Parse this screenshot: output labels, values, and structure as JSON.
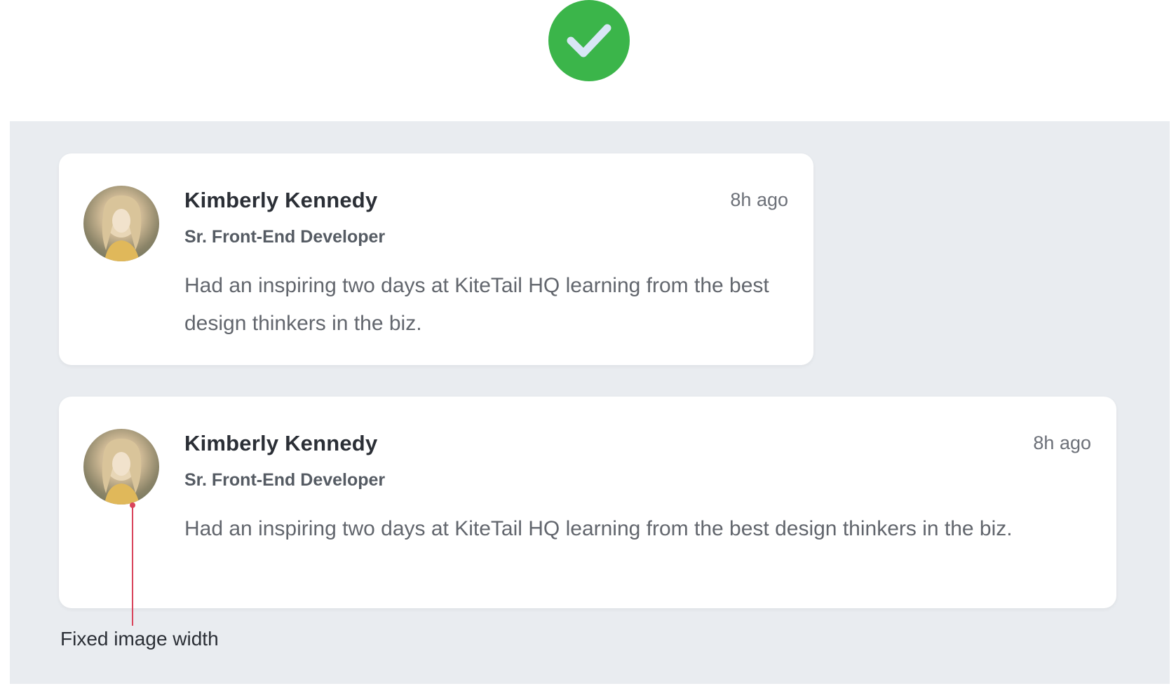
{
  "badge": {
    "icon": "check-icon",
    "color": "#3bb54a"
  },
  "cards": [
    {
      "name": "Kimberly Kennedy",
      "time": "8h ago",
      "role": "Sr. Front-End Developer",
      "body": "Had an inspiring two days at KiteTail HQ learning from the best design thinkers in the biz."
    },
    {
      "name": "Kimberly Kennedy",
      "time": "8h ago",
      "role": "Sr. Front-End Developer",
      "body": "Had an inspiring two days at KiteTail HQ learning from the best design thinkers in the biz."
    }
  ],
  "annotation": {
    "label": "Fixed image width",
    "color": "#d9455c"
  }
}
